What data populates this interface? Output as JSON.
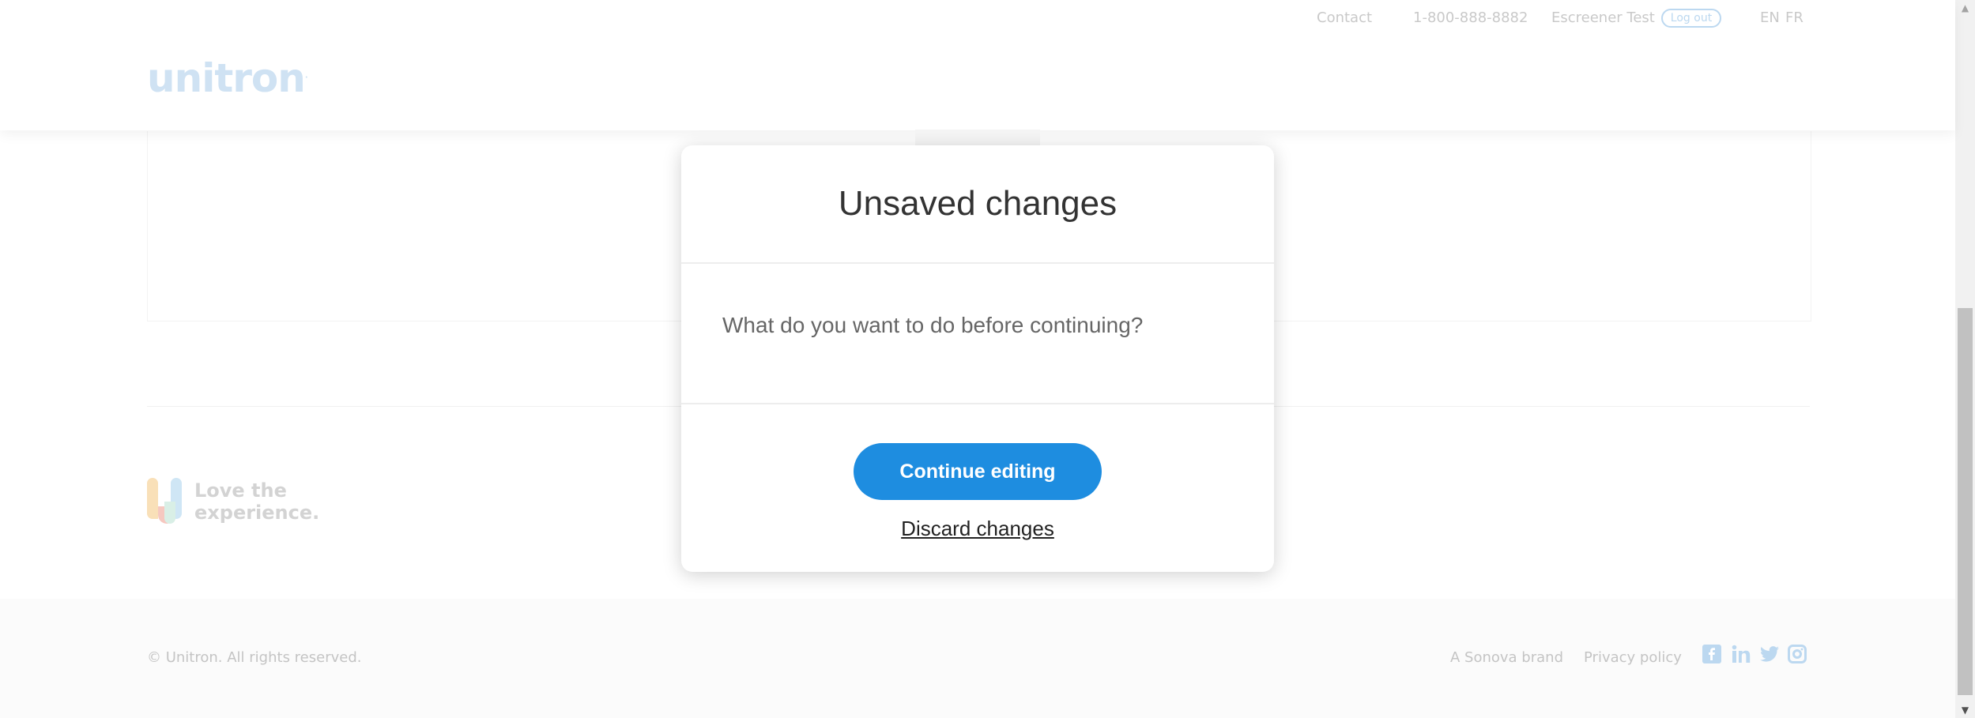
{
  "header": {
    "nav": {
      "contact": "Contact",
      "phone": "1-800-888-8882",
      "user_name": "Escreener Test",
      "logout_label": "Log out",
      "lang_en": "EN",
      "lang_fr": "FR"
    },
    "logo_text": "unitron"
  },
  "promo": {
    "line1": "Love the",
    "line2": "experience."
  },
  "footer": {
    "copyright": "© Unitron. All rights reserved.",
    "brand_link": "A Sonova brand",
    "privacy_link": "Privacy policy",
    "social_icons": [
      "facebook-icon",
      "linkedin-icon",
      "twitter-icon",
      "instagram-icon"
    ]
  },
  "modal": {
    "title": "Unsaved changes",
    "message": "What do you want to do before continuing?",
    "primary_label": "Continue editing",
    "secondary_label": "Discard changes"
  },
  "colors": {
    "accent": "#1e8de0",
    "faded_accent": "#bcd8f0"
  }
}
